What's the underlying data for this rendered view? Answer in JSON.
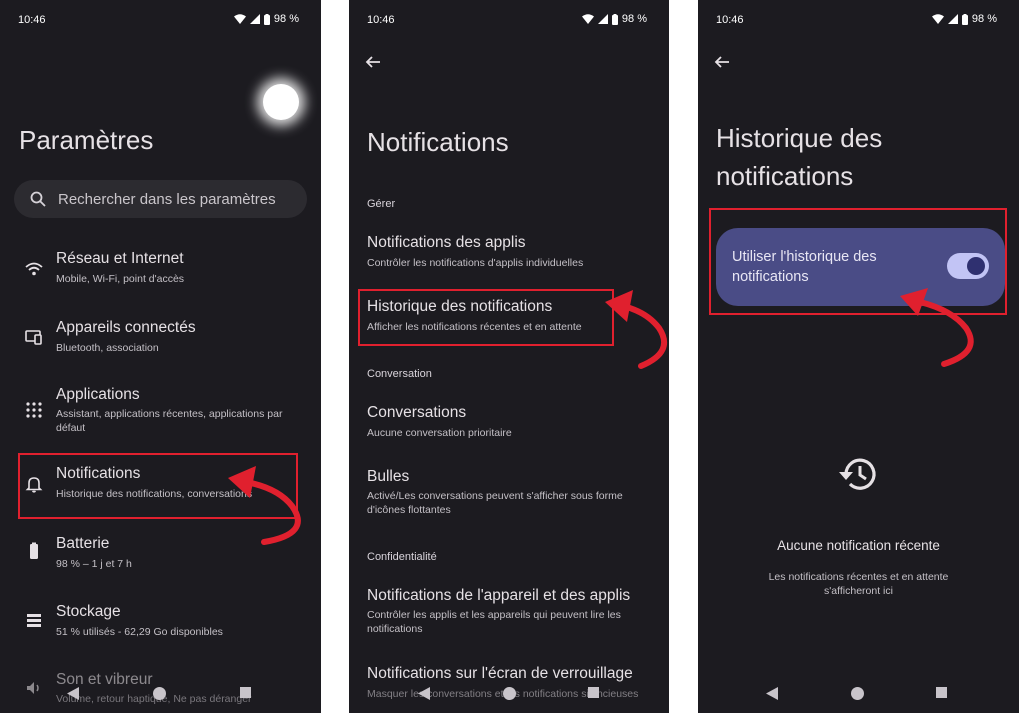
{
  "status_bar": {
    "time": "10:46",
    "battery": "98 %"
  },
  "screen1": {
    "title": "Paramètres",
    "search_placeholder": "Rechercher dans les paramètres",
    "items": [
      {
        "title": "Réseau et Internet",
        "subtitle": "Mobile, Wi-Fi, point d'accès",
        "icon": "wifi-icon"
      },
      {
        "title": "Appareils connectés",
        "subtitle": "Bluetooth, association",
        "icon": "devices-icon"
      },
      {
        "title": "Applications",
        "subtitle": "Assistant, applications récentes, applications par défaut",
        "icon": "apps-grid-icon"
      },
      {
        "title": "Notifications",
        "subtitle": "Historique des notifications, conversations",
        "icon": "bell-icon"
      },
      {
        "title": "Batterie",
        "subtitle": "98 % – 1 j et 7 h",
        "icon": "battery-icon"
      },
      {
        "title": "Stockage",
        "subtitle": "51 % utilisés - 62,29 Go disponibles",
        "icon": "storage-icon"
      },
      {
        "title": "Son et vibreur",
        "subtitle": "Volume, retour haptique, Ne pas déranger",
        "icon": "volume-icon"
      }
    ]
  },
  "screen2": {
    "title": "Notifications",
    "sections": [
      "Gérer",
      "Conversation",
      "Confidentialité"
    ],
    "items": [
      {
        "title": "Notifications des applis",
        "subtitle": "Contrôler les notifications d'applis individuelles"
      },
      {
        "title": "Historique des notifications",
        "subtitle": "Afficher les notifications récentes et en attente"
      },
      {
        "title": "Conversations",
        "subtitle": "Aucune conversation prioritaire"
      },
      {
        "title": "Bulles",
        "subtitle": "Activé/Les conversations peuvent s'afficher sous forme d'icônes flottantes"
      },
      {
        "title": "Notifications de l'appareil et des applis",
        "subtitle": "Contrôler les applis et les appareils qui peuvent lire les notifications"
      },
      {
        "title": "Notifications sur l'écran de verrouillage",
        "subtitle": "Masquer les conversations et les notifications silencieuses"
      }
    ]
  },
  "screen3": {
    "title_line1": "Historique des",
    "title_line2": "notifications",
    "toggle_label": "Utiliser l'historique des notifications",
    "toggle_on": true,
    "empty_title": "Aucune notification récente",
    "empty_subtitle": "Les notifications récentes et en attente s'afficheront ici"
  },
  "colors": {
    "background": "#1c1b20",
    "highlight": "#e0202e",
    "card": "#4a4c86",
    "toggle_track": "#c2c4f5"
  }
}
